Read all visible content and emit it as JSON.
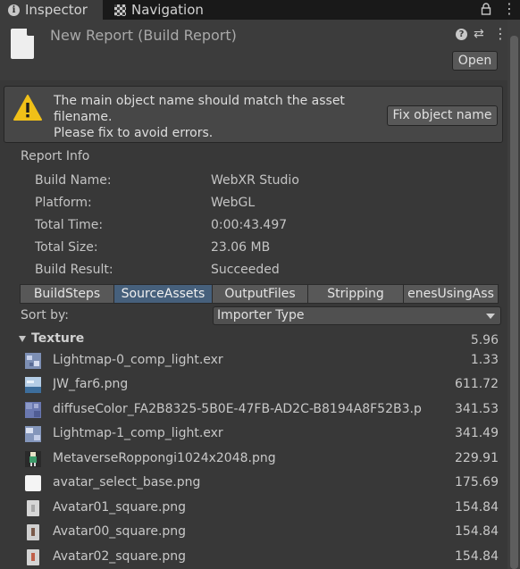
{
  "tabs": {
    "inspector": "Inspector",
    "navigation": "Navigation"
  },
  "header": {
    "title": "New Report (Build Report)",
    "open_label": "Open"
  },
  "warning": {
    "line1": "The main object name should match the asset",
    "line2": "filename.",
    "line3": "Please fix to avoid errors.",
    "fix_label": "Fix object name"
  },
  "report_info": {
    "label": "Report Info",
    "rows": [
      {
        "key": "Build Name:",
        "value": "WebXR Studio"
      },
      {
        "key": "Platform:",
        "value": "WebGL"
      },
      {
        "key": "Total Time:",
        "value": "0:00:43.497"
      },
      {
        "key": "Total Size:",
        "value": "23.06 MB"
      },
      {
        "key": "Build Result:",
        "value": "Succeeded"
      }
    ]
  },
  "toolbar_tabs": [
    {
      "label": "BuildSteps",
      "active": false
    },
    {
      "label": "SourceAssets",
      "active": true
    },
    {
      "label": "OutputFiles",
      "active": false
    },
    {
      "label": "Stripping",
      "active": false
    },
    {
      "label": "enesUsingAss",
      "active": false
    }
  ],
  "sort": {
    "label": "Sort by:",
    "selected": "Importer Type"
  },
  "group": {
    "name": "Texture",
    "value": "5.96"
  },
  "assets": [
    {
      "name": "Lightmap-0_comp_light.exr",
      "size": "1.33",
      "icon": "lightmap-thumb"
    },
    {
      "name": "JW_far6.png",
      "size": "611.72",
      "icon": "sky-thumb"
    },
    {
      "name": "diffuseColor_FA2B8325-5B0E-47FB-AD2C-B8194A8F52B3.p",
      "size": "341.53",
      "icon": "diffuse-thumb"
    },
    {
      "name": "Lightmap-1_comp_light.exr",
      "size": "341.49",
      "icon": "lightmap-thumb"
    },
    {
      "name": "MetaverseRoppongi1024x2048.png",
      "size": "229.91",
      "icon": "character-thumb"
    },
    {
      "name": "avatar_select_base.png",
      "size": "175.69",
      "icon": "white-thumb"
    },
    {
      "name": "Avatar01_square.png",
      "size": "154.84",
      "icon": "avatar-thumb"
    },
    {
      "name": "Avatar00_square.png",
      "size": "154.84",
      "icon": "avatar-thumb"
    },
    {
      "name": "Avatar02_square.png",
      "size": "154.84",
      "icon": "avatar-thumb"
    }
  ]
}
